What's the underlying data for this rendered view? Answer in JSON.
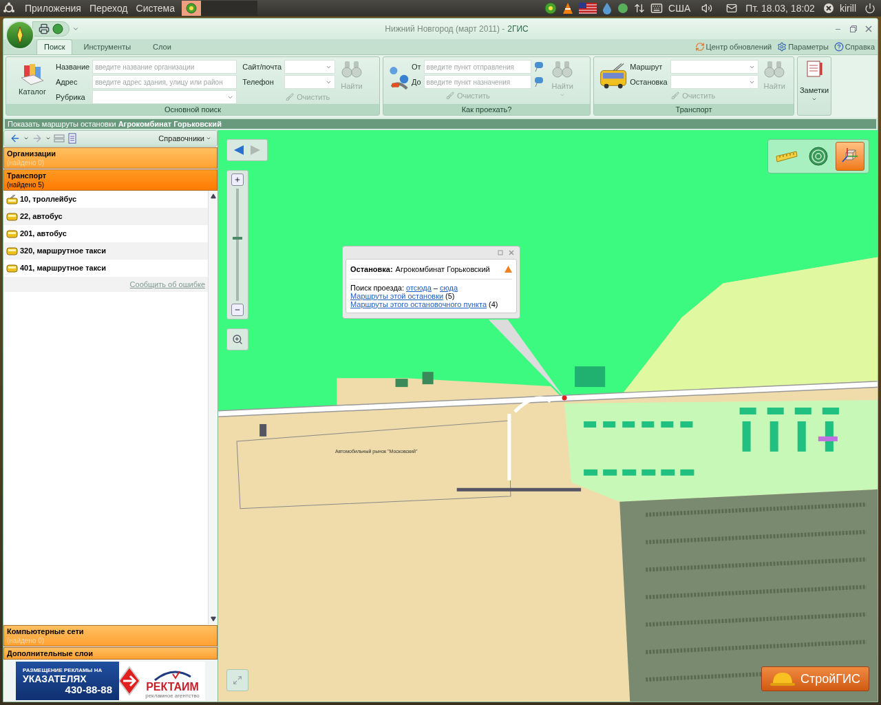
{
  "top_panel": {
    "menus": [
      "Приложения",
      "Переход",
      "Система"
    ],
    "keyboard_layout": "США",
    "clock": "Пт. 18.03, 18:02",
    "user": "kirill"
  },
  "window": {
    "title": "Нижний Новгород (март 2011) -",
    "app_name": "2ГИС"
  },
  "tabs": [
    {
      "label": "Поиск",
      "selected": true
    },
    {
      "label": "Инструменты",
      "selected": false
    },
    {
      "label": "Слои",
      "selected": false
    }
  ],
  "header_links": [
    {
      "label": "Центр обновлений",
      "kind": "updates"
    },
    {
      "label": "Параметры",
      "kind": "settings"
    },
    {
      "label": "Справка",
      "kind": "help"
    }
  ],
  "ribbon": {
    "main_search": {
      "title": "Основной поиск",
      "catalog": "Каталог",
      "fields": [
        {
          "label": "Название",
          "kind": "text",
          "placeholder": "введите название организации"
        },
        {
          "label": "Адрес",
          "kind": "text",
          "placeholder": "введите адрес здания, улицу или район"
        },
        {
          "label": "Рубрика",
          "kind": "dropdown"
        }
      ],
      "extra_fields": [
        {
          "label": "Сайт/почта",
          "kind": "dropdown"
        },
        {
          "label": "Телефон",
          "kind": "dropdown"
        }
      ],
      "clear": {
        "label": "Очистить",
        "disabled": true
      },
      "find": {
        "label": "Найти",
        "disabled": true,
        "menu": false
      }
    },
    "route": {
      "title": "Как проехать?",
      "fields": [
        {
          "label": "От",
          "kind": "text",
          "placeholder": "введите пункт отправления"
        },
        {
          "label": "До",
          "kind": "text",
          "placeholder": "введите пункт назначения"
        }
      ],
      "clear": {
        "label": "Очистить",
        "disabled": true
      },
      "find": {
        "label": "Найти",
        "disabled": true,
        "menu": true
      }
    },
    "transport": {
      "title": "Транспорт",
      "fields": [
        {
          "label": "Маршрут",
          "kind": "dropdown"
        },
        {
          "label": "Остановка",
          "kind": "dropdown"
        }
      ],
      "clear": {
        "label": "Очистить",
        "disabled": true
      },
      "find": {
        "label": "Найти",
        "disabled": true,
        "menu": false
      }
    },
    "notes": {
      "label": "Заметки"
    }
  },
  "hint_bar": "Показать маршруты остановки **Агрокомбинат Горьковский**",
  "sidebar": {
    "directories": "Справочники",
    "sections": [
      {
        "title": "Организации",
        "count": "(найдено 0)",
        "selected": false
      },
      {
        "title": "Транспорт",
        "count": "(найдено 5)",
        "selected": true,
        "report_link": "Сообщить об ошибке",
        "items": [
          {
            "label": "10, троллейбус",
            "kind": "trolleybus"
          },
          {
            "label": "22, автобус",
            "kind": "bus"
          },
          {
            "label": "201, автобус",
            "kind": "bus"
          },
          {
            "label": "320, маршрутное такси",
            "kind": "bus"
          },
          {
            "label": "401, маршрутное такси",
            "kind": "bus"
          }
        ]
      },
      {
        "title": "Компьютерные сети",
        "count": "(найдено 0)",
        "selected": false
      },
      {
        "title": "Дополнительные слои",
        "selected": false
      }
    ],
    "ad": {
      "line1": "РАЗМЕЩЕНИЕ РЕКЛАМЫ НА",
      "line2": "УКАЗАТЕЛЯХ",
      "phone": "430-88-88",
      "brand": "РЕКТАИМ",
      "brand_sub": "рекламное агентство"
    }
  },
  "map": {
    "label": "Автомобильный рынок \"Московский\"",
    "zoom": {
      "level": 0.56
    },
    "tools": [
      {
        "kind": "ruler",
        "selected": false
      },
      {
        "kind": "radar",
        "selected": false
      },
      {
        "kind": "cube",
        "selected": true
      }
    ],
    "popup": {
      "title": "Остановка:",
      "name": "Агрокомбинат Горьковский",
      "search_label": "Поиск проезда:",
      "from": "отсюда",
      "separator": "–",
      "to": "сюда",
      "links": [
        {
          "text": "Маршруты этой остановки",
          "count": "(5)"
        },
        {
          "text": "Маршруты этого остановочного пункта",
          "count": "(4)"
        }
      ]
    },
    "logo": "СтройГИС"
  }
}
